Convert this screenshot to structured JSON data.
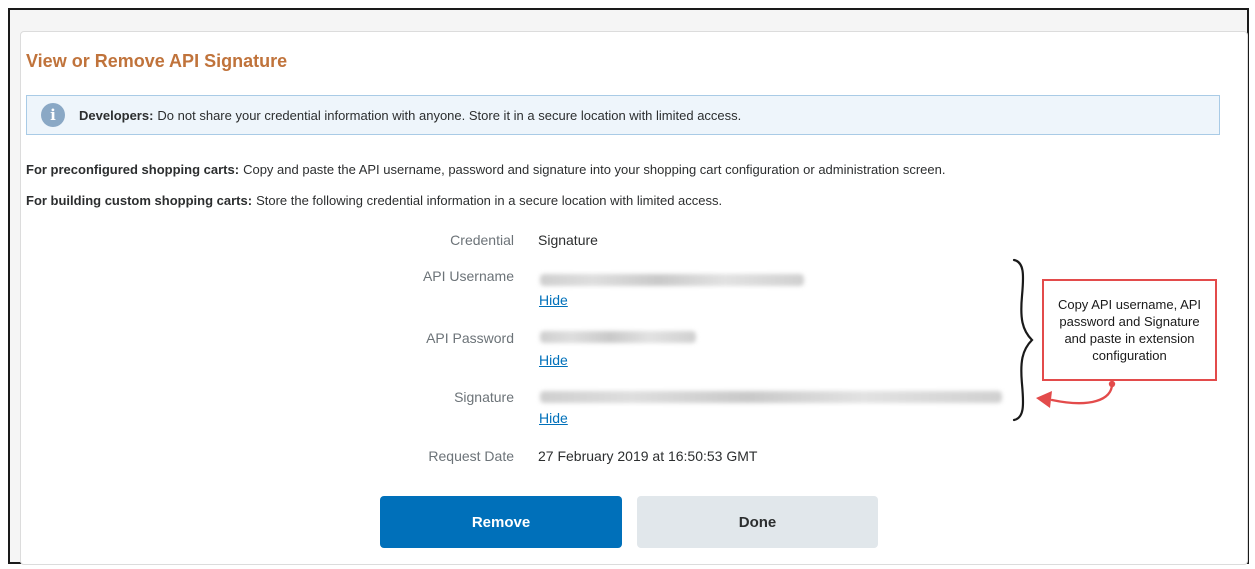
{
  "page": {
    "title": "View or Remove API Signature"
  },
  "alert": {
    "label": "Developers:",
    "text": "Do not share your credential information with anyone. Store it in a secure location with limited access."
  },
  "instructions": {
    "preconfigured_label": "For preconfigured shopping carts:",
    "preconfigured_text": "Copy and paste the API username, password and signature into your shopping cart configuration or administration screen.",
    "custom_label": "For building custom shopping carts:",
    "custom_text": "Store the following credential information in a secure location with limited access."
  },
  "details": {
    "credential_label": "Credential",
    "credential_value": "Signature",
    "api_username_label": "API Username",
    "api_password_label": "API Password",
    "signature_label": "Signature",
    "request_date_label": "Request Date",
    "request_date_value": "27 February 2019 at 16:50:53 GMT",
    "hide_link": "Hide"
  },
  "annotation": {
    "text": "Copy API username, API password and Signature and paste in extension configuration",
    "border_color": "#e34b4b"
  },
  "buttons": {
    "remove": "Remove",
    "done": "Done"
  },
  "colors": {
    "title": "#c0733b",
    "primary": "#0070ba",
    "secondary": "#e1e7eb",
    "alert_bg": "#eef5fb"
  }
}
